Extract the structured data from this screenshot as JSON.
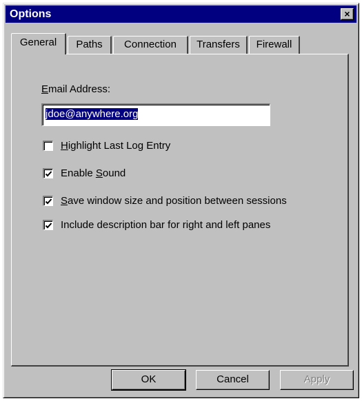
{
  "window": {
    "title": "Options",
    "close_glyph": "×"
  },
  "tabs": [
    {
      "label": "General",
      "active": true
    },
    {
      "label": "Paths",
      "active": false
    },
    {
      "label": "Connection",
      "active": false
    },
    {
      "label": "Transfers",
      "active": false
    },
    {
      "label": "Firewall",
      "active": false
    }
  ],
  "general": {
    "email_label_mnemonic": "E",
    "email_label_rest": "mail Address:",
    "email_value": "jdoe@anywhere.org",
    "checkboxes": [
      {
        "mnemonic": "H",
        "rest": "ighlight Last Log Entry",
        "checked": false
      },
      {
        "pre": "Enable ",
        "mnemonic": "S",
        "rest": "ound",
        "checked": true
      },
      {
        "mnemonic": "S",
        "rest": "ave window size and position between sessions",
        "checked": true
      },
      {
        "mnemonic": "",
        "rest": "Include description bar for right and left panes",
        "checked": true
      }
    ]
  },
  "buttons": {
    "ok": "OK",
    "cancel": "Cancel",
    "apply": "Apply"
  }
}
